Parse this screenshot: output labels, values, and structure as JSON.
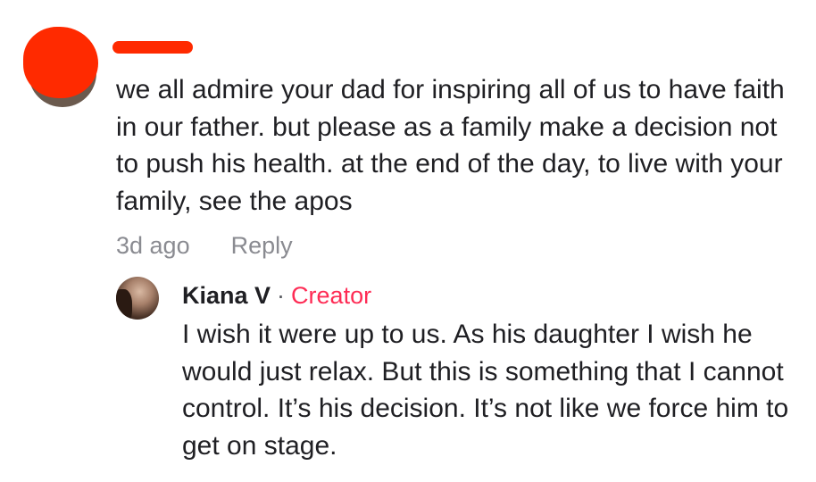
{
  "comment": {
    "avatar": "user-avatar",
    "username": "",
    "text": "we all admire your dad for inspiring all of us to have faith in our father. but please as a family make a decision not to push his health. at the end of the day, to live with your family, see the apos",
    "time": "3d ago",
    "reply_label": "Reply"
  },
  "reply": {
    "avatar": "creator-avatar",
    "author": "Kiana V",
    "separator": "·",
    "badge": "Creator",
    "text": "I wish it were up to us. As his daughter I wish he would just relax. But this is something that I cannot control. It’s his decision. It’s not like we force him to get on stage.",
    "time": "",
    "reply_label": ""
  },
  "colors": {
    "text": "#1f1f23",
    "muted": "#8a8b91",
    "creator": "#fe2c55",
    "redaction": "#ff2a00"
  }
}
